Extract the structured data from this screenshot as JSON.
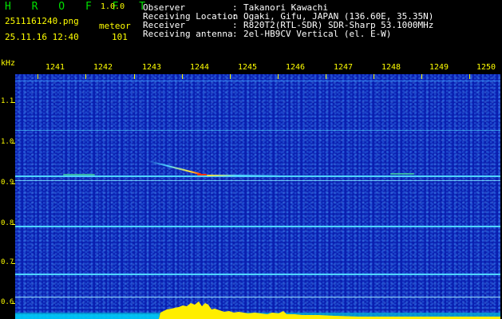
{
  "app": {
    "logo": "H R O F F T",
    "version": "1.0.0"
  },
  "capture": {
    "filename": "2511161240.png",
    "timestamp": "25.11.16 12:40",
    "mode": "meteor",
    "count": "101"
  },
  "station": [
    {
      "label": "Observer",
      "value": "Takanori Kawachi"
    },
    {
      "label": "Receiving Location",
      "value": "Ogaki, Gifu, JAPAN (136.60E, 35.35N)"
    },
    {
      "label": "Receiver",
      "value": "R820T2(RTL-SDR) SDR-Sharp 53.1000MHz"
    },
    {
      "label": "Receiving antenna",
      "value": "2el-HB9CV Vertical (el. E-W)"
    }
  ],
  "axes": {
    "y_unit": "kHz",
    "y_ticks": [
      "1.1",
      "1.0",
      "0.9",
      "0.8",
      "0.7",
      "0.6"
    ],
    "x_ticks": [
      "1241",
      "1242",
      "1243",
      "1244",
      "1245",
      "1246",
      "1247",
      "1248",
      "1249",
      "1250"
    ]
  },
  "colors": {
    "label": "#ffff00",
    "logo": "#00e000",
    "spectrogram_bg": "#0a1fb0",
    "signal": "#4fd4ff"
  }
}
